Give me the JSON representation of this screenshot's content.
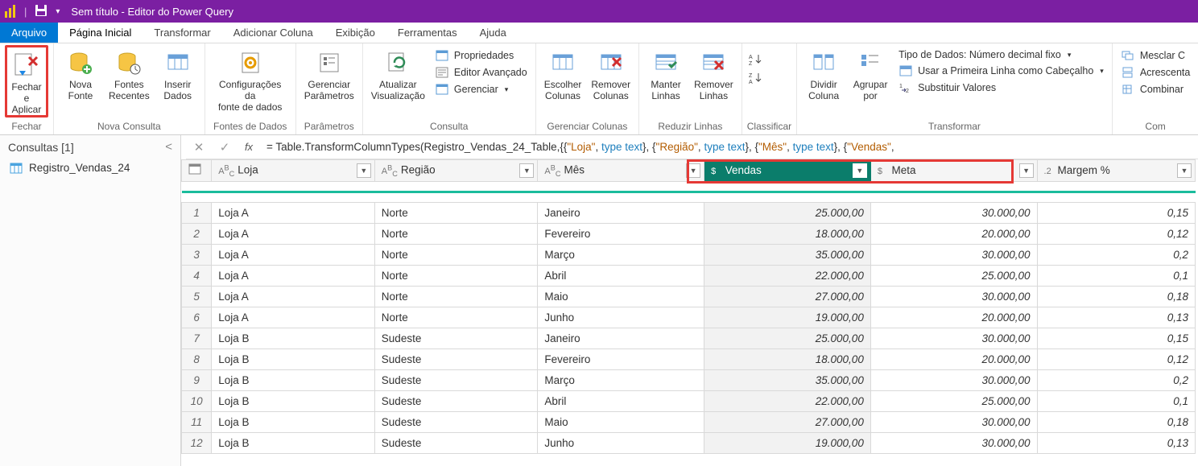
{
  "titlebar": {
    "title": "Sem título - Editor do Power Query"
  },
  "tabs": {
    "file": "Arquivo",
    "home": "Página Inicial",
    "transform": "Transformar",
    "addcol": "Adicionar Coluna",
    "view": "Exibição",
    "tools": "Ferramentas",
    "help": "Ajuda"
  },
  "ribbon": {
    "close_apply": "Fechar e\nAplicar",
    "new_source": "Nova\nFonte",
    "recent_sources": "Fontes\nRecentes",
    "enter_data": "Inserir\nDados",
    "ds_settings": "Configurações da\nfonte de dados",
    "manage_params": "Gerenciar\nParâmetros",
    "refresh_preview": "Atualizar\nVisualização",
    "properties": "Propriedades",
    "adv_editor": "Editor Avançado",
    "manage": "Gerenciar",
    "choose_cols": "Escolher\nColunas",
    "remove_cols": "Remover\nColunas",
    "keep_rows": "Manter\nLinhas",
    "remove_rows": "Remover\nLinhas",
    "split_col": "Dividir\nColuna",
    "group_by": "Agrupar\npor",
    "datatype_label": "Tipo de Dados: Número decimal fixo",
    "first_row_header": "Usar a Primeira Linha como Cabeçalho",
    "replace_values": "Substituir Valores",
    "merge_q": "Mesclar C",
    "append_q": "Acrescenta",
    "combine_f": "Combinar",
    "group_close": "Fechar",
    "group_newquery": "Nova Consulta",
    "group_datasources": "Fontes de Dados",
    "group_params": "Parâmetros",
    "group_query": "Consulta",
    "group_cols": "Gerenciar Colunas",
    "group_rows": "Reduzir Linhas",
    "group_sort": "Classificar",
    "group_transform": "Transformar",
    "group_combine": "Com"
  },
  "queries_panel": {
    "title": "Consultas [1]",
    "item": "Registro_Vendas_24"
  },
  "formula": {
    "prefix": "= Table.TransformColumnTypes(Registro_Vendas_24_Table,{{",
    "s1": "\"Loja\"",
    "k1": "type text",
    "s2": "\"Região\"",
    "k2": "type text",
    "s3": "\"Mês\"",
    "k3": "type text",
    "s4": "\"Vendas\""
  },
  "grid": {
    "headers": {
      "loja": "Loja",
      "regiao": "Região",
      "mes": "Mês",
      "vendas": "Vendas",
      "meta": "Meta",
      "margem": "Margem %",
      "abc": "ABC",
      "dollar": "$",
      "dec12": ".2"
    },
    "rows": [
      {
        "n": "1",
        "loja": "Loja A",
        "regiao": "Norte",
        "mes": "Janeiro",
        "vendas": "25.000,00",
        "meta": "30.000,00",
        "margem": "0,15"
      },
      {
        "n": "2",
        "loja": "Loja A",
        "regiao": "Norte",
        "mes": "Fevereiro",
        "vendas": "18.000,00",
        "meta": "20.000,00",
        "margem": "0,12"
      },
      {
        "n": "3",
        "loja": "Loja A",
        "regiao": "Norte",
        "mes": "Março",
        "vendas": "35.000,00",
        "meta": "30.000,00",
        "margem": "0,2"
      },
      {
        "n": "4",
        "loja": "Loja A",
        "regiao": "Norte",
        "mes": "Abril",
        "vendas": "22.000,00",
        "meta": "25.000,00",
        "margem": "0,1"
      },
      {
        "n": "5",
        "loja": "Loja A",
        "regiao": "Norte",
        "mes": "Maio",
        "vendas": "27.000,00",
        "meta": "30.000,00",
        "margem": "0,18"
      },
      {
        "n": "6",
        "loja": "Loja A",
        "regiao": "Norte",
        "mes": "Junho",
        "vendas": "19.000,00",
        "meta": "20.000,00",
        "margem": "0,13"
      },
      {
        "n": "7",
        "loja": "Loja B",
        "regiao": "Sudeste",
        "mes": "Janeiro",
        "vendas": "25.000,00",
        "meta": "30.000,00",
        "margem": "0,15"
      },
      {
        "n": "8",
        "loja": "Loja B",
        "regiao": "Sudeste",
        "mes": "Fevereiro",
        "vendas": "18.000,00",
        "meta": "20.000,00",
        "margem": "0,12"
      },
      {
        "n": "9",
        "loja": "Loja B",
        "regiao": "Sudeste",
        "mes": "Março",
        "vendas": "35.000,00",
        "meta": "30.000,00",
        "margem": "0,2"
      },
      {
        "n": "10",
        "loja": "Loja B",
        "regiao": "Sudeste",
        "mes": "Abril",
        "vendas": "22.000,00",
        "meta": "25.000,00",
        "margem": "0,1"
      },
      {
        "n": "11",
        "loja": "Loja B",
        "regiao": "Sudeste",
        "mes": "Maio",
        "vendas": "27.000,00",
        "meta": "30.000,00",
        "margem": "0,18"
      },
      {
        "n": "12",
        "loja": "Loja B",
        "regiao": "Sudeste",
        "mes": "Junho",
        "vendas": "19.000,00",
        "meta": "30.000,00",
        "margem": "0,13"
      }
    ]
  }
}
